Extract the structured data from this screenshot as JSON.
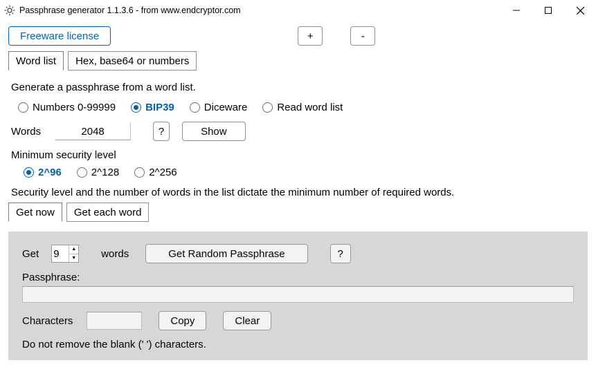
{
  "window": {
    "title": "Passphrase generator 1.1.3.6 - from www.endcryptor.com"
  },
  "top": {
    "license_button": "Freeware license",
    "plus": "+",
    "minus": "-"
  },
  "tabs_main": [
    {
      "label": "Word list",
      "active": true
    },
    {
      "label": "Hex, base64 or numbers",
      "active": false
    }
  ],
  "wordlist": {
    "heading": "Generate a passphrase from a word list.",
    "source_options": [
      {
        "label": "Numbers 0-99999",
        "selected": false
      },
      {
        "label": "BIP39",
        "selected": true
      },
      {
        "label": "Diceware",
        "selected": false
      },
      {
        "label": "Read word list",
        "selected": false
      }
    ],
    "words_label": "Words",
    "words_value": "2048",
    "help_button": "?",
    "show_button": "Show",
    "min_sec_label": "Minimum security level",
    "sec_options": [
      {
        "label": "2^96",
        "selected": true
      },
      {
        "label": "2^128",
        "selected": false
      },
      {
        "label": "2^256",
        "selected": false
      }
    ],
    "explain": "Security level and the number of words in the list dictate the minimum number of required words."
  },
  "tabs_lower": [
    {
      "label": "Get now",
      "active": true
    },
    {
      "label": "Get each word",
      "active": false
    }
  ],
  "getnow": {
    "get_label_pre": "Get",
    "count_value": "9",
    "get_label_post": "words",
    "get_random_button": "Get Random Passphrase",
    "help_button": "?",
    "passphrase_label": "Passphrase:",
    "passphrase_value": "",
    "characters_label": "Characters",
    "characters_value": "",
    "copy_button": "Copy",
    "clear_button": "Clear",
    "note": "Do not remove the blank (' ') characters."
  }
}
